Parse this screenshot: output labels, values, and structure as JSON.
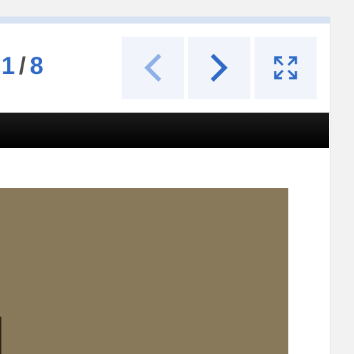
{
  "viewer": {
    "counter": {
      "current": "1",
      "separator": "/",
      "total": "8"
    },
    "buttons": {
      "previous": {
        "icon": "chevron-left-icon",
        "enabled": false,
        "color": "#8fb0e6"
      },
      "next": {
        "icon": "chevron-right-icon",
        "enabled": true,
        "color": "#2f6bc6"
      },
      "fullscreen": {
        "icon": "expand-icon",
        "color": "#2f6bc6"
      }
    },
    "colors": {
      "accent": "#2f6bc6",
      "button_bg": "#f1f5fb",
      "toolbar": "#000000",
      "image": "#88795a"
    }
  }
}
